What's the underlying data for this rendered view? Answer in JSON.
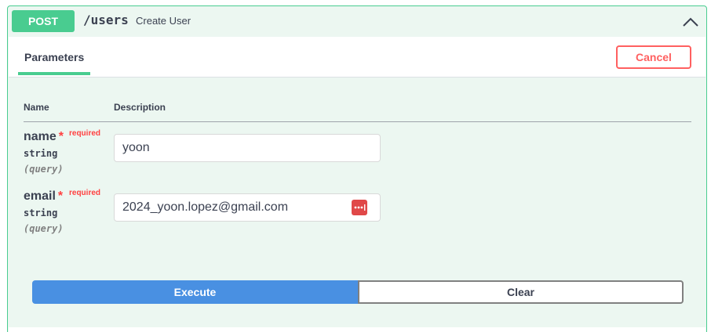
{
  "operation": {
    "method": "POST",
    "path": "/users",
    "summary": "Create User",
    "collapse_icon": "chevron-up-icon",
    "method_color": "#49cc90"
  },
  "tabs": {
    "parameters": "Parameters",
    "cancel_label": "Cancel"
  },
  "table": {
    "col_name": "Name",
    "col_description": "Description"
  },
  "params": [
    {
      "name": "name",
      "required_mark": "*",
      "required_label": "required",
      "type": "string",
      "in": "(query)",
      "value": "yoon"
    },
    {
      "name": "email",
      "required_mark": "*",
      "required_label": "required",
      "type": "string",
      "in": "(query)",
      "value": "2024_yoon.lopez@gmail.com",
      "field_icon": "password-manager-icon"
    }
  ],
  "actions": {
    "execute_label": "Execute",
    "clear_label": "Clear",
    "execute_color": "#4990e2",
    "cancel_color": "#ff6060"
  }
}
